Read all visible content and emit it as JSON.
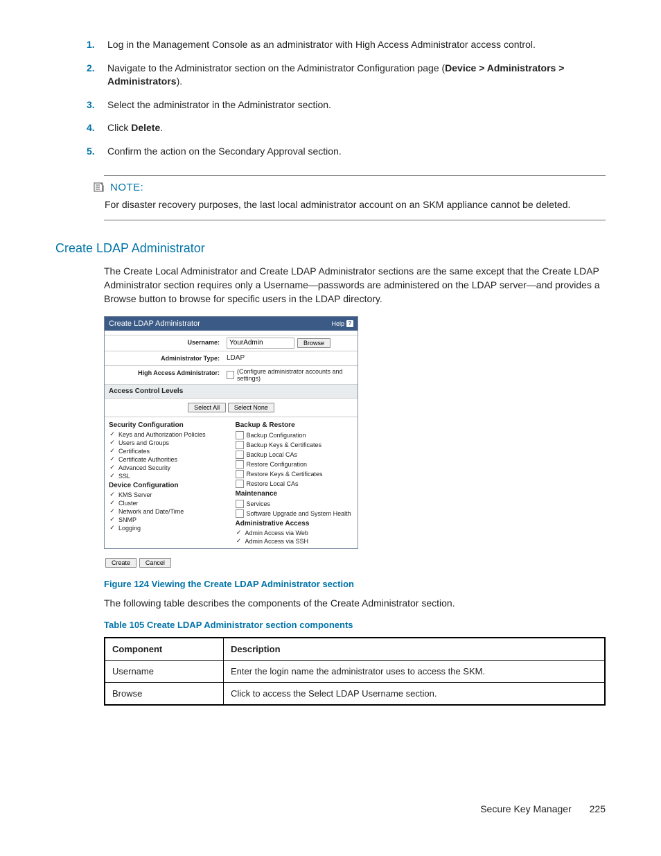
{
  "steps": [
    {
      "n": "1.",
      "text_a": "Log in the Management Console as an administrator with High Access Administrator access control."
    },
    {
      "n": "2.",
      "text_a": "Navigate to the Administrator section on the Administrator Configuration page (",
      "bold": "Device > Administrators > Administrators",
      "text_b": ")."
    },
    {
      "n": "3.",
      "text_a": "Select the administrator in the Administrator section."
    },
    {
      "n": "4.",
      "text_a": "Click ",
      "bold": "Delete",
      "text_b": "."
    },
    {
      "n": "5.",
      "text_a": "Confirm the action on the Secondary Approval section."
    }
  ],
  "note": {
    "label": "NOTE:",
    "text": "For disaster recovery purposes, the last local administrator account on an SKM appliance cannot be deleted."
  },
  "section_heading": "Create LDAP Administrator",
  "section_intro": "The Create Local Administrator and Create LDAP Administrator sections are the same except that the Create LDAP Administrator section requires only a Username—passwords are administered on the LDAP server—and provides a Browse button to browse for specific users in the LDAP directory.",
  "panel": {
    "title": "Create LDAP Administrator",
    "help": "Help",
    "fields": {
      "username_label": "Username:",
      "username_value": "YourAdmin",
      "browse": "Browse",
      "type_label": "Administrator Type:",
      "type_value": "LDAP",
      "high_label": "High Access Administrator:",
      "high_desc": "(Configure administrator accounts and settings)"
    },
    "acl_header": "Access Control Levels",
    "select_all": "Select All",
    "select_none": "Select None",
    "left": [
      {
        "head": "Security Configuration"
      },
      {
        "on": true,
        "label": "Keys and Authorization Policies"
      },
      {
        "on": true,
        "label": "Users and Groups"
      },
      {
        "on": true,
        "label": "Certificates"
      },
      {
        "on": true,
        "label": "Certificate Authorities"
      },
      {
        "on": true,
        "label": "Advanced Security"
      },
      {
        "on": true,
        "label": "SSL"
      },
      {
        "head": "Device Configuration"
      },
      {
        "on": true,
        "label": "KMS Server"
      },
      {
        "on": true,
        "label": "Cluster"
      },
      {
        "on": true,
        "label": "Network and Date/Time"
      },
      {
        "on": true,
        "label": "SNMP"
      },
      {
        "on": true,
        "label": "Logging"
      }
    ],
    "right": [
      {
        "head": "Backup & Restore"
      },
      {
        "box": true,
        "label": "Backup Configuration"
      },
      {
        "box": true,
        "label": "Backup Keys & Certificates"
      },
      {
        "box": true,
        "label": "Backup Local CAs"
      },
      {
        "box": true,
        "label": "Restore Configuration"
      },
      {
        "box": true,
        "label": "Restore Keys & Certificates"
      },
      {
        "box": true,
        "label": "Restore Local CAs"
      },
      {
        "head": "Maintenance"
      },
      {
        "box": true,
        "label": "Services"
      },
      {
        "box": true,
        "label": "Software Upgrade and System Health"
      },
      {
        "head": "Administrative Access"
      },
      {
        "on": true,
        "label": "Admin Access via Web"
      },
      {
        "on": true,
        "label": "Admin Access via SSH"
      }
    ],
    "create": "Create",
    "cancel": "Cancel"
  },
  "figure_caption": "Figure 124 Viewing the Create LDAP Administrator section",
  "table_intro": "The following table describes the components of the Create Administrator section.",
  "table_caption": "Table 105 Create LDAP Administrator section components",
  "table": {
    "h1": "Component",
    "h2": "Description",
    "rows": [
      {
        "c": "Username",
        "d": "Enter the login name the administrator uses to access the SKM."
      },
      {
        "c": "Browse",
        "d": "Click to access the Select LDAP Username section."
      }
    ]
  },
  "footer": {
    "title": "Secure Key Manager",
    "page": "225"
  }
}
